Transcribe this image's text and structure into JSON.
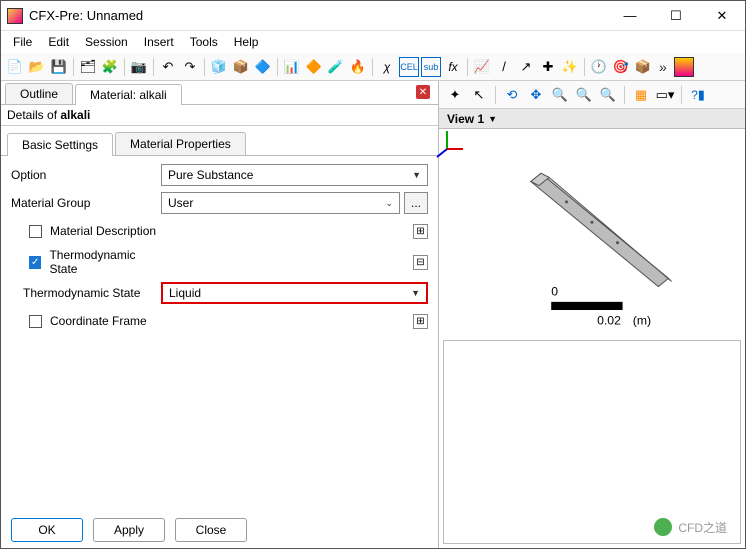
{
  "window": {
    "title": "CFX-Pre:  Unnamed",
    "min": "—",
    "max": "☐",
    "close": "✕"
  },
  "menu": [
    "File",
    "Edit",
    "Session",
    "Insert",
    "Tools",
    "Help"
  ],
  "toolbar_more": "»",
  "tabs": {
    "outline": "Outline",
    "material": "Material: alkali",
    "close_x": "✕"
  },
  "details": {
    "prefix": "Details of ",
    "name": "alkali"
  },
  "inner_tabs": {
    "basic": "Basic Settings",
    "props": "Material Properties"
  },
  "form": {
    "option_lbl": "Option",
    "option_val": "Pure Substance",
    "group_lbl": "Material Group",
    "group_val": "User",
    "ellipsis": "...",
    "desc_lbl": "Material Description",
    "thermo_chk_lbl": "Thermodynamic State",
    "thermo_state_lbl": "Thermodynamic State",
    "thermo_state_val": "Liquid",
    "coord_lbl": "Coordinate Frame",
    "plus": "⊞",
    "minus": "⊟"
  },
  "buttons": {
    "ok": "OK",
    "apply": "Apply",
    "close": "Close"
  },
  "rightbar": {
    "view_label": "View 1 ",
    "caret": "▼",
    "help": "?"
  },
  "scale": {
    "zero": "0",
    "val": "0.02",
    "unit": "(m)"
  },
  "watermark": "CFD之道"
}
